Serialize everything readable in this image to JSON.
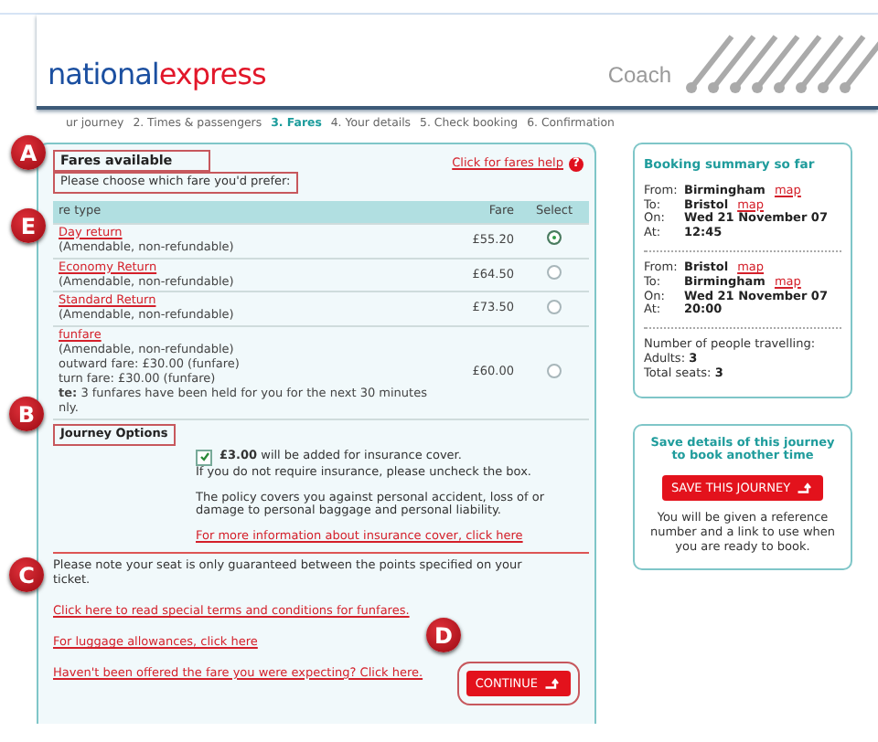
{
  "header": {
    "logo_first": "national",
    "logo_second": "express",
    "section": "Coach"
  },
  "steps": [
    {
      "label": "ur journey",
      "selected": false
    },
    {
      "label": "2. Times & passengers",
      "selected": false
    },
    {
      "label": "3. Fares",
      "selected": true
    },
    {
      "label": "4. Your details",
      "selected": false
    },
    {
      "label": "5. Check booking",
      "selected": false
    },
    {
      "label": "6. Confirmation",
      "selected": false
    }
  ],
  "fares": {
    "title": "Fares available",
    "help_link": "Click for fares help",
    "help_icon": "?",
    "prompt": "Please choose which fare you'd prefer:",
    "columns": [
      "re type",
      "Fare",
      "Select"
    ],
    "rows": [
      {
        "name": "Day return",
        "lines": [
          "(Amendable, non-refundable)"
        ],
        "fare": "£55.20",
        "selected": true
      },
      {
        "name": "Economy Return",
        "lines": [
          "(Amendable, non-refundable)"
        ],
        "fare": "£64.50",
        "selected": false
      },
      {
        "name": "Standard Return",
        "lines": [
          "(Amendable, non-refundable)"
        ],
        "fare": "£73.50",
        "selected": false
      },
      {
        "name": "funfare",
        "lines": [
          "(Amendable, non-refundable)",
          "outward fare: £30.00 (funfare)",
          "turn fare: £30.00 (funfare)",
          "**te:** 3 funfares have been held for you for the next 30 minutes",
          "nly."
        ],
        "fare": "£60.00",
        "selected": false
      }
    ]
  },
  "options": {
    "title": "Journey Options",
    "insurance_checked": true,
    "insurance_text": "**£3.00** will be added for insurance cover.",
    "uncheck_text": "If you do not require insurance, please uncheck the box.",
    "policy": "The policy covers you against personal accident, loss of or damage to personal baggage and personal liability.",
    "link": "For more information about insurance cover, click here"
  },
  "notice": "Please note your seat is only guaranteed between the points specified on your ticket.",
  "links": [
    "Click here to read special terms and conditions for funfares.",
    "For luggage allowances, click here",
    "Haven't been offered the fare you were expecting? Click here."
  ],
  "continue_button": "CONTINUE",
  "summary": {
    "title": "Booking summary so far",
    "journeys": [
      {
        "rows": [
          {
            "label": "From:",
            "value": "Birmingham",
            "link": "map"
          },
          {
            "label": "To:",
            "value": "Bristol",
            "link": "map"
          },
          {
            "label": "On:",
            "value": "Wed 21 November 07"
          },
          {
            "label": "At:",
            "value": "12:45"
          }
        ]
      },
      {
        "rows": [
          {
            "label": "From:",
            "value": "Bristol",
            "link": "map"
          },
          {
            "label": "To:",
            "value": "Birmingham",
            "link": "map"
          },
          {
            "label": "On:",
            "value": "Wed 21 November 07"
          },
          {
            "label": "At:",
            "value": "20:00"
          }
        ]
      }
    ],
    "people_title": "Number of people travelling:",
    "people": [
      {
        "label": "Adults:",
        "value": "3"
      },
      {
        "label": "Total seats:",
        "value": "3"
      }
    ]
  },
  "save": {
    "title": "Save details of this journey to book another time",
    "button": "SAVE THIS JOURNEY",
    "text": "You will be given a reference number and a link to use when you are ready to book."
  },
  "markers": [
    {
      "label": "A"
    },
    {
      "label": "E"
    },
    {
      "label": "B"
    },
    {
      "label": "C"
    },
    {
      "label": "D"
    }
  ]
}
